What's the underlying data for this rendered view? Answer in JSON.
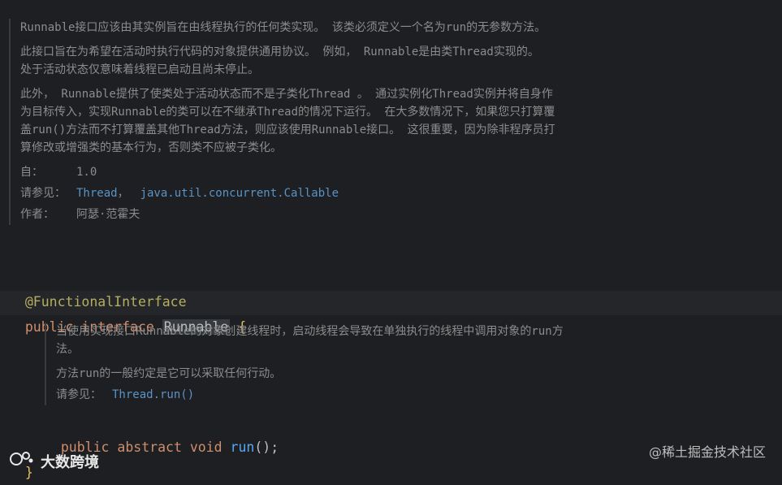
{
  "doc_top": {
    "para1": "Runnable接口应该由其实例旨在由线程执行的任何类实现。 该类必须定义一个名为run的无参数方法。",
    "para2": "此接口旨在为希望在活动时执行代码的对象提供通用协议。 例如， Runnable是由类Thread实现的。 处于活动状态仅意味着线程已启动且尚未停止。",
    "para3": "此外， Runnable提供了使类处于活动状态而不是子类化Thread 。 通过实例化Thread实例并将自身作为目标传入，实现Runnable的类可以在不继承Thread的情况下运行。 在大多数情况下，如果您只打算覆盖run()方法而不打算覆盖其他Thread方法，则应该使用Runnable接口。 这很重要，因为除非程序员打算修改或增强类的基本行为，否则类不应被子类化。",
    "since_label": "自：",
    "since_value": "1.0",
    "see_label": "请参见：",
    "see_link1": "Thread",
    "see_sep": " ，",
    "see_link2": "java.util.concurrent.Callable",
    "author_label": "作者：",
    "author_value": "阿瑟·范霍夫"
  },
  "code": {
    "annotation": "@FunctionalInterface",
    "kw_public": "public",
    "kw_interface": "interface",
    "class_name": "Runnable",
    "open_brace": "{",
    "method_kw_public": "public",
    "method_kw_abstract": "abstract",
    "method_kw_void": "void",
    "method_name": "run",
    "method_tail": "();",
    "close_brace": "}"
  },
  "doc_method": {
    "para1": "当使用实现接口Runnable的对象创建线程时，启动线程会导致在单独执行的线程中调用对象的run方法。",
    "para2": "方法run的一般约定是它可以采取任何行动。",
    "see_label": "请参见：",
    "see_link": "Thread.run()"
  },
  "watermark": {
    "left_text": "大数跨境",
    "right_text": "@稀土掘金技术社区"
  }
}
